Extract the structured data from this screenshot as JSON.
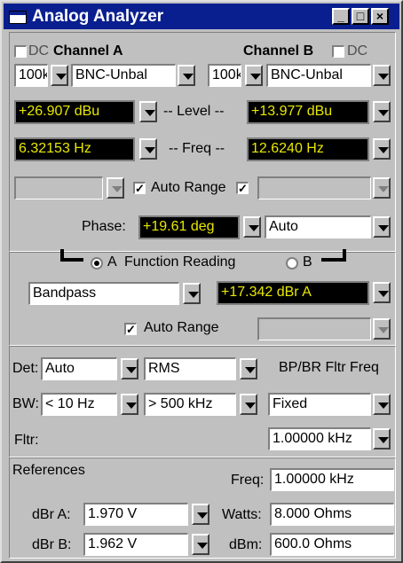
{
  "window": {
    "title": "Analog Analyzer",
    "minimize": "_",
    "maximize": "□",
    "close": "×"
  },
  "channel_a": {
    "dc_label": "DC",
    "title": "Channel A",
    "range": "100k",
    "input": "BNC-Unbal",
    "level": "+26.907  dBu",
    "freq": "6.32153  Hz"
  },
  "channel_b": {
    "dc_label": "DC",
    "title": "Channel B",
    "range": "100k",
    "input": "BNC-Unbal",
    "level": "+13.977  dBu",
    "freq": "12.6240  Hz"
  },
  "labels": {
    "level": "-- Level --",
    "freq": "-- Freq --",
    "auto_range": "Auto Range",
    "phase": "Phase:"
  },
  "phase": {
    "value": "+19.61  deg",
    "mode": "Auto"
  },
  "function": {
    "radio_a": "A",
    "title": "Function Reading",
    "radio_b": "B",
    "filter": "Bandpass",
    "reading": "+17.342  dBr A",
    "auto_range": "Auto Range"
  },
  "detector": {
    "det_label": "Det:",
    "det_value": "Auto",
    "det_type": "RMS",
    "bw_label": "BW:",
    "bw_low": "< 10 Hz",
    "bw_high": "> 500 kHz",
    "fltr_label": "Fltr:"
  },
  "bp_br": {
    "title": "BP/BR Fltr Freq",
    "mode": "Fixed",
    "freq": "1.00000 kHz"
  },
  "references": {
    "title": "References",
    "freq_label": "Freq:",
    "freq_value": "1.00000 kHz",
    "dbra_label": "dBr A:",
    "dbra_value": "1.970     V",
    "watts_label": "Watts:",
    "watts_value": "8.000     Ohms",
    "dbrb_label": "dBr B:",
    "dbrb_value": "1.962     V",
    "dbm_label": "dBm:",
    "dbm_value": "600.0     Ohms"
  }
}
